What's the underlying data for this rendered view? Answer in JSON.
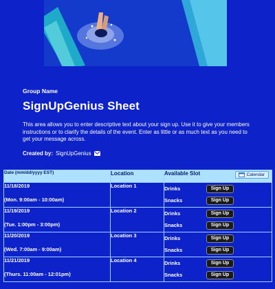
{
  "banner": {
    "alt": "diver"
  },
  "header": {
    "group_name": "Group Name",
    "title": "SignUpGenius Sheet",
    "description": "This area allows you to enter descriptive text about your sign up. Use it to give your members instructions or to clarify the details of the event. Enter as little or as much text as you need to get your message across.",
    "created_by_label": "Created by:",
    "created_by_name": "SignUpGenius"
  },
  "table": {
    "headers": {
      "date": "Date (mm/dd/yyyy EST)",
      "location": "Location",
      "slot": "Available Slot",
      "calendar_button": "Calendar"
    },
    "rows": [
      {
        "date": "11/18/2019",
        "time": "(Mon. 9:00am - 10:00am)",
        "location": "Location 1",
        "slots": [
          {
            "name": "Drinks",
            "button": "Sign Up"
          },
          {
            "name": "Snacks",
            "button": "Sign Up"
          }
        ]
      },
      {
        "date": "11/19/2019",
        "time": "(Tue. 1:00pm - 3:00pm)",
        "location": "Location 2",
        "slots": [
          {
            "name": "Drinks",
            "button": "Sign Up"
          },
          {
            "name": "Snacks",
            "button": "Sign Up"
          }
        ]
      },
      {
        "date": "11/20/2019",
        "time": "(Wed. 7:00am - 9:00am)",
        "location": "Location 3",
        "slots": [
          {
            "name": "Drinks",
            "button": "Sign Up"
          },
          {
            "name": "Snacks",
            "button": "Sign Up"
          }
        ]
      },
      {
        "date": "11/21/2019",
        "time": "(Thurs. 11:00am - 12:01pm)",
        "location": "Location 4",
        "slots": [
          {
            "name": "Drinks",
            "button": "Sign Up"
          },
          {
            "name": "Snacks",
            "button": "Sign Up"
          }
        ]
      }
    ]
  },
  "colors": {
    "background": "#0d22c8",
    "header_row": "#aee0ff",
    "border": "#9fd2ff"
  }
}
